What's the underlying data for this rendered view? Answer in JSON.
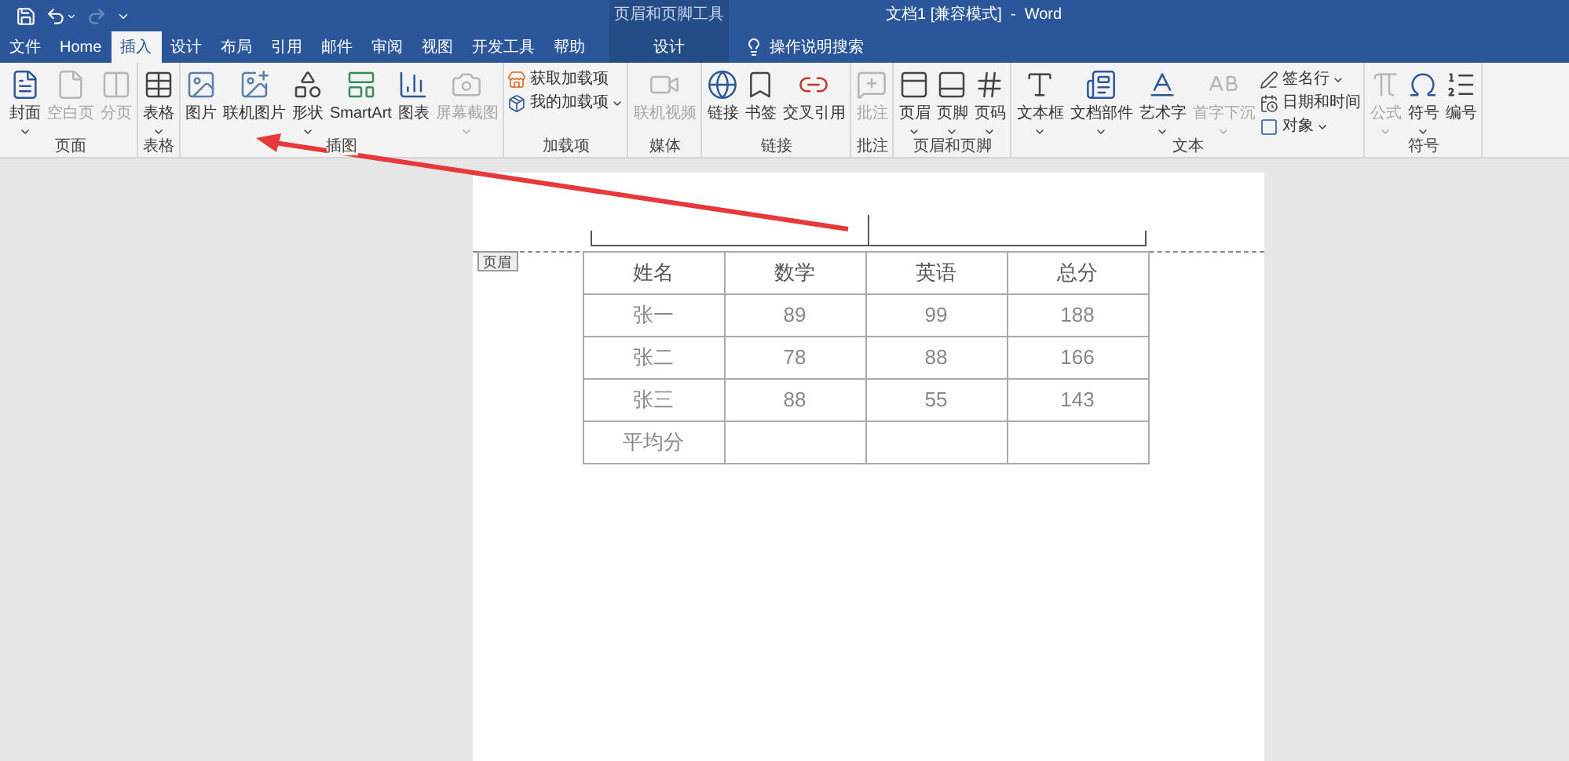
{
  "window": {
    "title": "文档1 [兼容模式]  -  Word",
    "contextual_group": "页眉和页脚工具"
  },
  "quick_access": [
    {
      "disabled": false,
      "dropdown": false
    },
    {
      "disabled": false,
      "dropdown": true
    },
    {
      "disabled": true,
      "dropdown": false
    },
    {
      "disabled": false,
      "dropdown": false
    }
  ],
  "tabs": [
    {
      "label": "文件",
      "selected": false,
      "contextual": false
    },
    {
      "label": "Home",
      "selected": false,
      "contextual": false
    },
    {
      "label": "插入",
      "selected": true,
      "contextual": false
    },
    {
      "label": "设计",
      "selected": false,
      "contextual": false
    },
    {
      "label": "布局",
      "selected": false,
      "contextual": false
    },
    {
      "label": "引用",
      "selected": false,
      "contextual": false
    },
    {
      "label": "邮件",
      "selected": false,
      "contextual": false
    },
    {
      "label": "审阅",
      "selected": false,
      "contextual": false
    },
    {
      "label": "视图",
      "selected": false,
      "contextual": false
    },
    {
      "label": "开发工具",
      "selected": false,
      "contextual": false
    },
    {
      "label": "帮助",
      "selected": false,
      "contextual": false
    },
    {
      "label": "设计",
      "selected": false,
      "contextual": true
    }
  ],
  "search": {
    "placeholder": "操作说明搜索"
  },
  "ribbon": [
    {
      "label": "页面",
      "items": [
        {
          "kind": "large",
          "label": "封面",
          "disabled": false,
          "dropdown": true
        },
        {
          "kind": "large",
          "label": "空白页",
          "disabled": true,
          "dropdown": false
        },
        {
          "kind": "large",
          "label": "分页",
          "disabled": true,
          "dropdown": false
        }
      ]
    },
    {
      "label": "表格",
      "items": [
        {
          "kind": "large",
          "label": "表格",
          "disabled": false,
          "dropdown": true
        }
      ]
    },
    {
      "label": "插图",
      "items": [
        {
          "kind": "large",
          "label": "图片",
          "disabled": false,
          "dropdown": false
        },
        {
          "kind": "large",
          "label": "联机图片",
          "disabled": false,
          "dropdown": false
        },
        {
          "kind": "large",
          "label": "形状",
          "disabled": false,
          "dropdown": true
        },
        {
          "kind": "large",
          "label": "SmartArt",
          "disabled": false,
          "dropdown": false
        },
        {
          "kind": "large",
          "label": "图表",
          "disabled": false,
          "dropdown": false
        },
        {
          "kind": "large",
          "label": "屏幕截图",
          "disabled": true,
          "dropdown": true
        }
      ]
    },
    {
      "label": "加载项",
      "items": [
        {
          "kind": "small",
          "label": "获取加载项",
          "disabled": false,
          "dropdown": false
        },
        {
          "kind": "small",
          "label": "我的加载项",
          "disabled": false,
          "dropdown": true
        }
      ]
    },
    {
      "label": "媒体",
      "items": [
        {
          "kind": "large",
          "label": "联机视频",
          "disabled": true,
          "dropdown": false
        }
      ]
    },
    {
      "label": "链接",
      "items": [
        {
          "kind": "large",
          "label": "链接",
          "disabled": false,
          "dropdown": false
        },
        {
          "kind": "large",
          "label": "书签",
          "disabled": false,
          "dropdown": false
        },
        {
          "kind": "large",
          "label": "交叉引用",
          "disabled": false,
          "dropdown": false
        }
      ]
    },
    {
      "label": "批注",
      "items": [
        {
          "kind": "large",
          "label": "批注",
          "disabled": true,
          "dropdown": false
        }
      ]
    },
    {
      "label": "页眉和页脚",
      "items": [
        {
          "kind": "large",
          "label": "页眉",
          "disabled": false,
          "dropdown": true
        },
        {
          "kind": "large",
          "label": "页脚",
          "disabled": false,
          "dropdown": true
        },
        {
          "kind": "large",
          "label": "页码",
          "disabled": false,
          "dropdown": true
        }
      ]
    },
    {
      "label": "文本",
      "items": [
        {
          "kind": "large",
          "label": "文本框",
          "disabled": false,
          "dropdown": true
        },
        {
          "kind": "large",
          "label": "文档部件",
          "disabled": false,
          "dropdown": true
        },
        {
          "kind": "large",
          "label": "艺术字",
          "disabled": false,
          "dropdown": true
        },
        {
          "kind": "large",
          "label": "首字下沉",
          "disabled": true,
          "dropdown": true
        },
        {
          "kind": "small",
          "label": "签名行",
          "disabled": false,
          "dropdown": true
        },
        {
          "kind": "small",
          "label": "日期和时间",
          "disabled": false,
          "dropdown": false
        },
        {
          "kind": "small",
          "label": "对象",
          "disabled": false,
          "dropdown": true
        }
      ]
    },
    {
      "label": "符号",
      "items": [
        {
          "kind": "large",
          "label": "公式",
          "disabled": true,
          "dropdown": true
        },
        {
          "kind": "large",
          "label": "符号",
          "disabled": false,
          "dropdown": true
        },
        {
          "kind": "large",
          "label": "编号",
          "disabled": false,
          "dropdown": false
        }
      ]
    }
  ],
  "document": {
    "header_tag": "页眉",
    "table": {
      "columns": [
        "姓名",
        "数学",
        "英语",
        "总分"
      ],
      "rows": [
        [
          "张一",
          "89",
          "99",
          "188"
        ],
        [
          "张二",
          "78",
          "88",
          "166"
        ],
        [
          "张三",
          "88",
          "55",
          "143"
        ],
        [
          "平均分",
          "",
          "",
          ""
        ]
      ]
    }
  }
}
